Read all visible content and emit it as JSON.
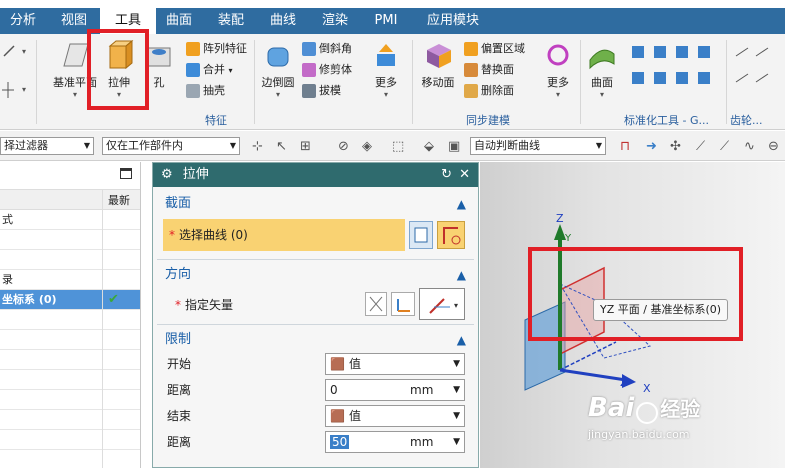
{
  "menubar": {
    "tabs": [
      "分析",
      "视图",
      "工具",
      "曲面",
      "装配",
      "曲线",
      "渲染",
      "PMI",
      "应用模块"
    ],
    "active": "工具"
  },
  "ribbon": {
    "feature": {
      "datum_plane": "基准平面",
      "extrude": "拉伸",
      "hole": "孔",
      "pattern_feature": "阵列特征",
      "unite": "合并",
      "shell": "抽壳",
      "group_label": "特征"
    },
    "edge": {
      "edge_blend": "边倒圆",
      "chamfer": "倒斜角",
      "trim_body": "修剪体",
      "draft": "拔模",
      "more": "更多"
    },
    "sync": {
      "move_face": "移动面",
      "offset_region": "偏置区域",
      "replace_face": "替换面",
      "delete_face": "删除面",
      "more": "更多",
      "group_label": "同步建模"
    },
    "surface": {
      "surface": "曲面",
      "standard_tools": "标准化工具 - G...",
      "gear": "齿轮..."
    }
  },
  "filterbar": {
    "selection_filter": "择过滤器",
    "scope": "仅在工作部件内",
    "curve_rule": "自动判断曲线"
  },
  "left_panel": {
    "col_latest": "最新",
    "rows": [
      "式",
      "",
      "",
      "录",
      "坐标系 (0)"
    ]
  },
  "dialog": {
    "title": "拉伸",
    "section": "截面",
    "select_curve": "选择曲线 (0)",
    "direction": "方向",
    "specify_vector": "指定矢量",
    "limits": "限制",
    "start_label": "开始",
    "start_value": "值",
    "distance_label": "距离",
    "start_distance": "0",
    "unit": "mm",
    "end_label": "结束",
    "end_value": "值",
    "end_distance": "50"
  },
  "viewport": {
    "tooltip": "YZ 平面 / 基准坐标系(0)",
    "axis_z": "Z",
    "axis_y": "Y",
    "axis_x": "X",
    "watermark_brand": "Bai",
    "watermark_brand2": "经验",
    "watermark_url": "jingyan.baidu.com"
  },
  "colors": {
    "menubar": "#2f6ca0",
    "highlight_red": "#e11f26",
    "selection_yellow": "#f9d272",
    "dialog_title": "#2f6b6e",
    "selected_row": "#4f93d8"
  }
}
